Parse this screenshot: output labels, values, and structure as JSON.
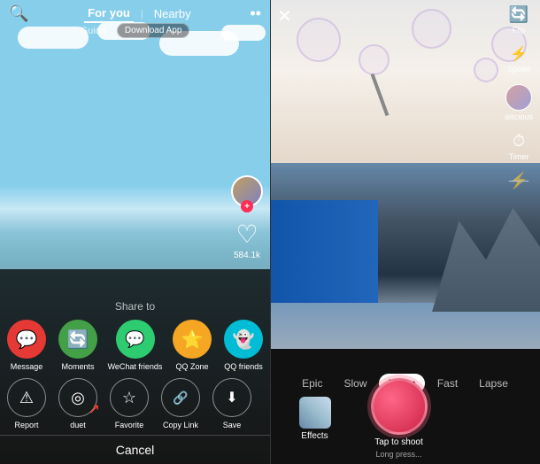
{
  "left": {
    "topTabs": {
      "forYou": "For you",
      "nearby": "Nearby"
    },
    "guide": "Guide",
    "downloadApp": "Download App",
    "likeCount": "584.1k",
    "shareTo": "Share to",
    "shareIcons": [
      {
        "label": "Message",
        "color": "#e53935",
        "icon": "💬"
      },
      {
        "label": "Moments",
        "color": "#43a047",
        "icon": "🔄"
      },
      {
        "label": "WeChat friends",
        "color": "#2ecc71",
        "icon": "💬"
      },
      {
        "label": "QQ Zone",
        "color": "#f5a623",
        "icon": "⭐"
      },
      {
        "label": "QQ friends",
        "color": "#00bcd4",
        "icon": "👻"
      }
    ],
    "actionIcons": [
      {
        "label": "Report",
        "icon": "⚠"
      },
      {
        "label": "duet",
        "icon": "◎",
        "hasArrow": true
      },
      {
        "label": "Favorite",
        "icon": "☆"
      },
      {
        "label": "Copy Link",
        "icon": "🔗"
      },
      {
        "label": "Save",
        "icon": "⬇"
      }
    ],
    "cancel": "Cancel"
  },
  "right": {
    "controls": {
      "flip": "Flip",
      "speed": "Speed",
      "filter": "ielicious",
      "timer": "Timer"
    },
    "speedTabs": [
      "Epic",
      "Slow",
      "Norm",
      "Fast",
      "Lapse"
    ],
    "activeSpeedTab": "Norm",
    "effects": "Effects",
    "tapToShoot": "Tap to shoot",
    "longPress": "Long press..."
  }
}
